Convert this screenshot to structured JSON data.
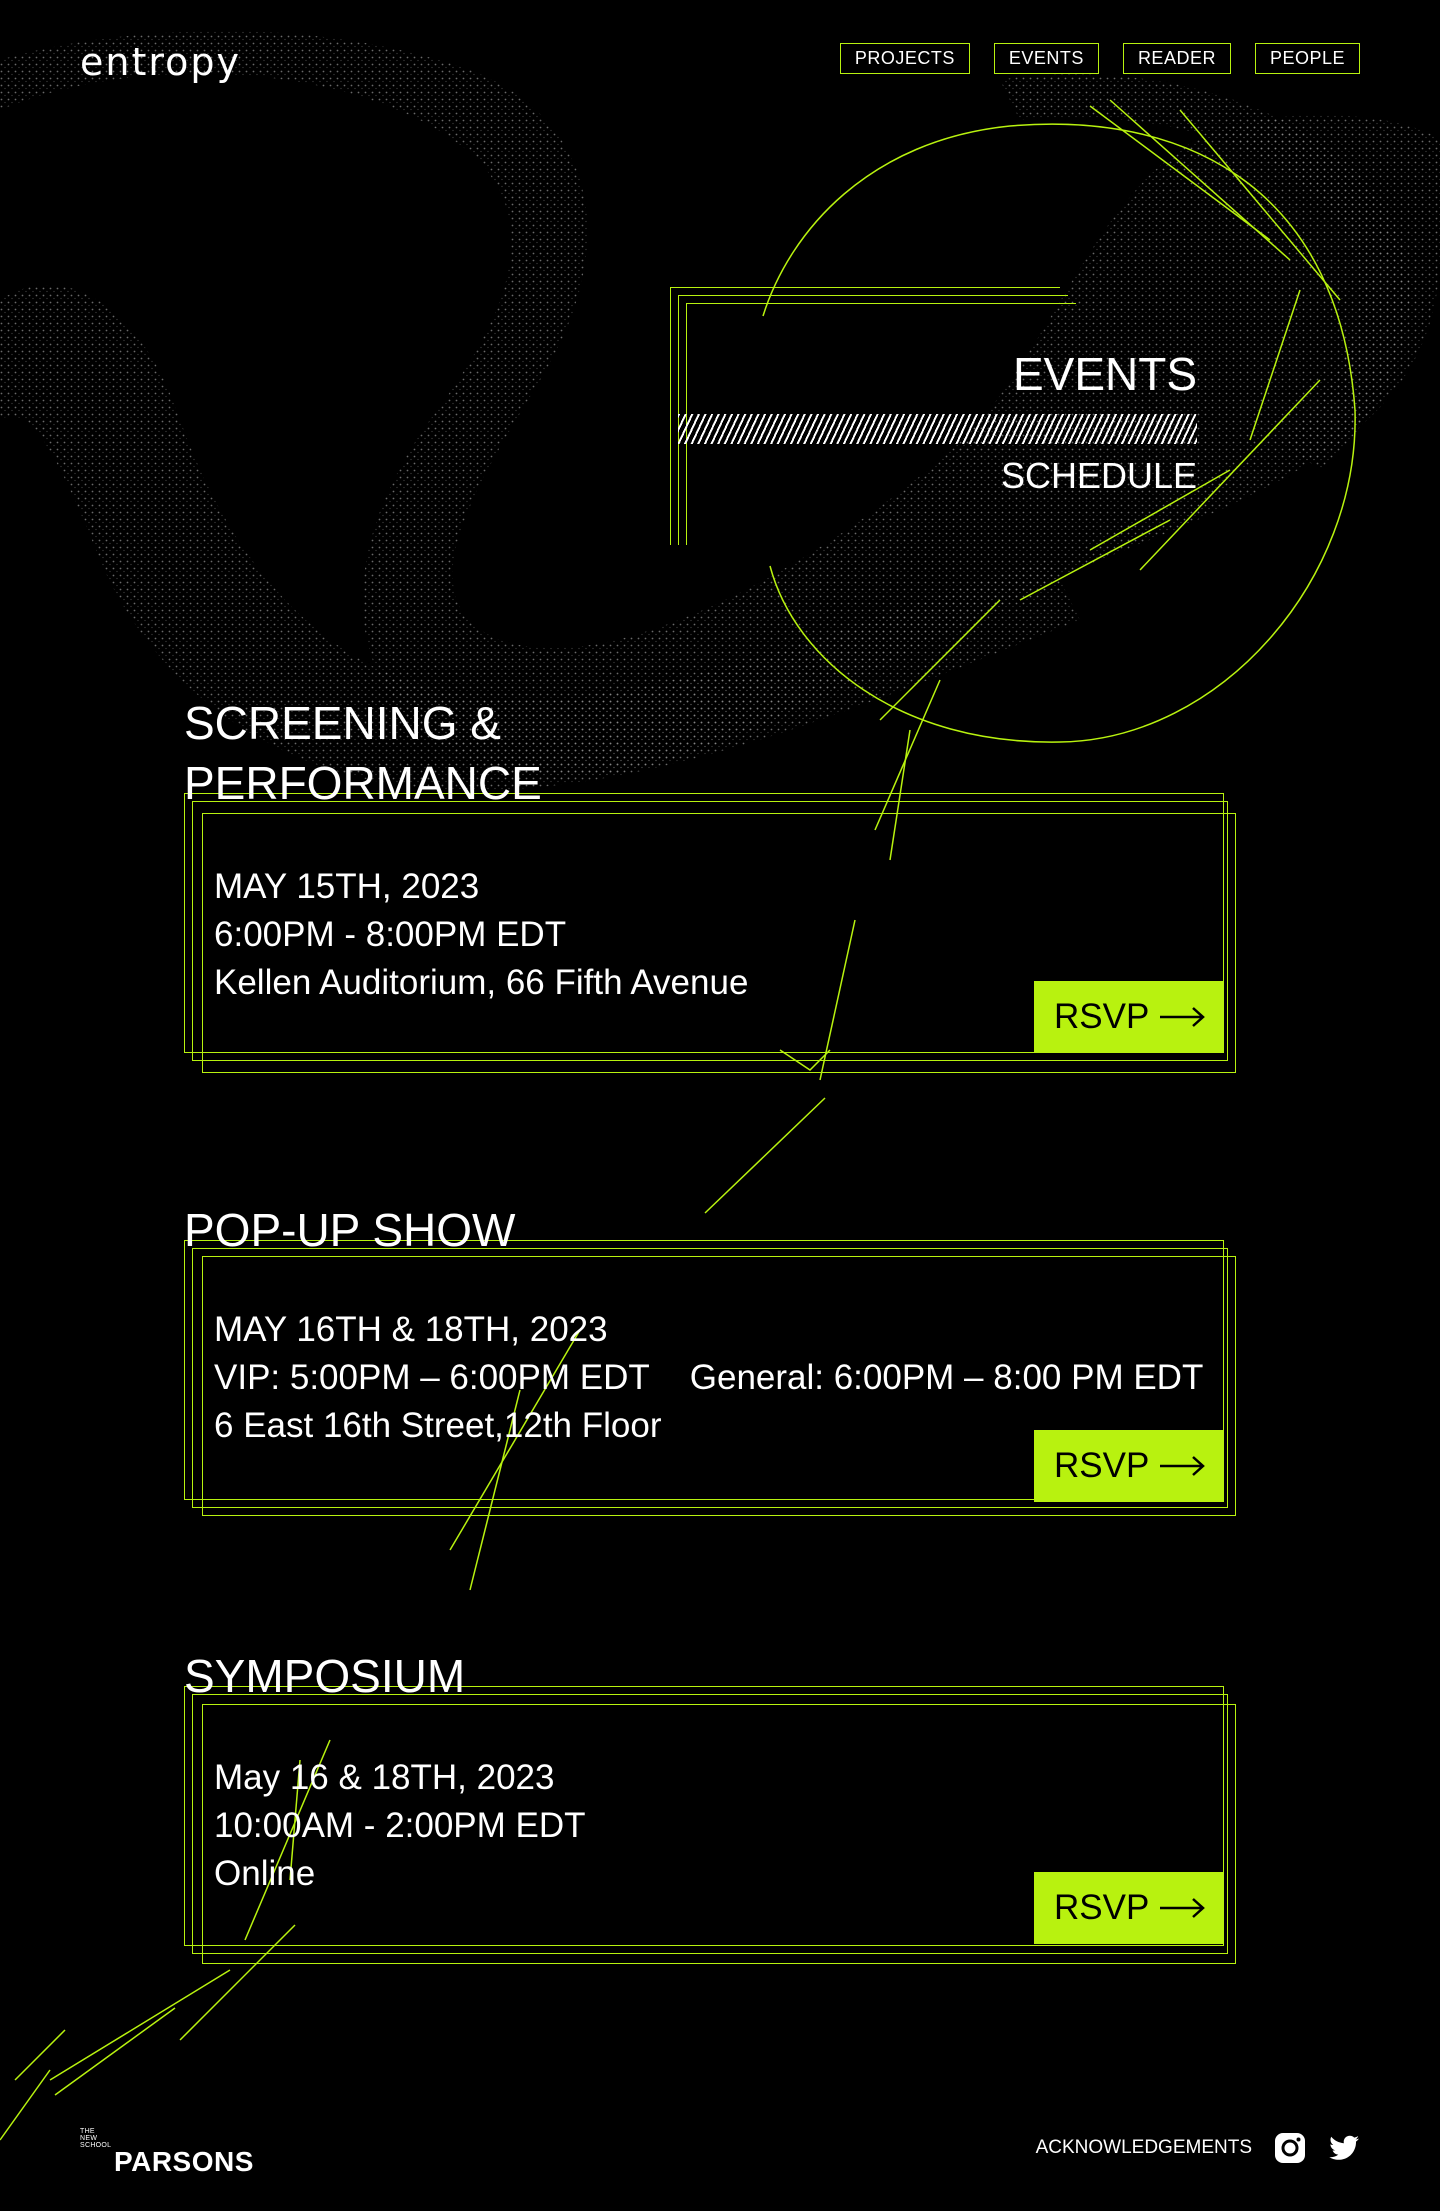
{
  "colors": {
    "accent": "#b8f20f",
    "background": "#000000",
    "text": "#ffffff"
  },
  "header": {
    "logo": "entropy",
    "nav": [
      "PROJECTS",
      "EVENTS",
      "READER",
      "PEOPLE"
    ]
  },
  "hero": {
    "title": "EVENTS",
    "subtitle": "SCHEDULE"
  },
  "events": [
    {
      "title_line1": "SCREENING &",
      "title_line2": "PERFORMANCE",
      "date": "MAY 15TH, 2023",
      "time": "6:00PM - 8:00PM EDT",
      "location": "Kellen Auditorium, 66 Fifth Avenue",
      "button": "RSVP"
    },
    {
      "title": "POP-UP SHOW",
      "date": "MAY 16TH & 18TH, 2023",
      "time_vip": "VIP: 5:00PM – 6:00PM EDT",
      "time_general": "General: 6:00PM – 8:00 PM EDT",
      "location": "6 East 16th Street,12th Floor",
      "button": "RSVP"
    },
    {
      "title": "SYMPOSIUM",
      "date": "May 16 & 18TH, 2023",
      "time": "10:00AM - 2:00PM EDT",
      "location": "Online",
      "button": "RSVP"
    }
  ],
  "footer": {
    "school_small": [
      "THE",
      "NEW",
      "SCHOOL"
    ],
    "school_name": "PARSONS",
    "acknowledgements": "ACKNOWLEDGEMENTS",
    "icons": [
      "instagram-icon",
      "twitter-icon"
    ]
  }
}
